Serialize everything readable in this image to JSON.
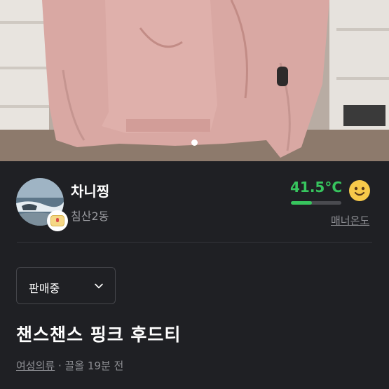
{
  "product_photo": {
    "description_icon": "pink-hoodie-photo",
    "carousel_dot_count": 1,
    "active_dot": 0
  },
  "seller": {
    "name": "차니찡",
    "location": "침산2동",
    "avatar_icon": "seaside-avatar-icon",
    "badge_icon": "calendar-badge-icon"
  },
  "manner": {
    "temperature": "41.5°C",
    "temperature_level": 0.42,
    "label": "매너온도",
    "emoji_icon": "smile-face-icon",
    "color": "#37c55e"
  },
  "status": {
    "selected": "판매중",
    "chevron_icon": "chevron-down-icon"
  },
  "post": {
    "title": "챈스챈스 핑크 후드티",
    "category": "여성의류",
    "separator": " · ",
    "time": "끌올 19분 전"
  },
  "colors": {
    "background": "#1f2024",
    "accent_green": "#37c55e",
    "muted_text": "#8e8f94"
  }
}
